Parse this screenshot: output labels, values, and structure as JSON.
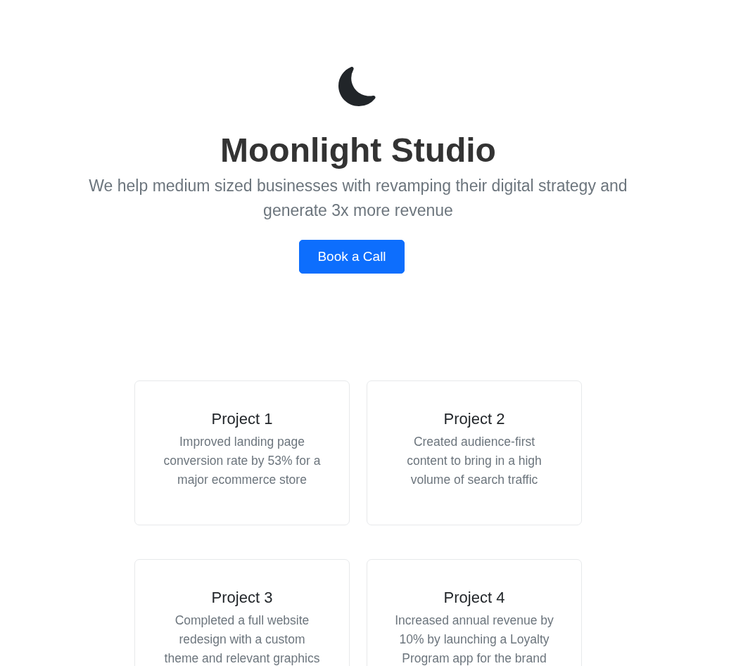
{
  "hero": {
    "title": "Moonlight Studio",
    "subtitle": "We help medium sized businesses with revamping their digital strategy and generate 3x more revenue",
    "button": "Book a Call"
  },
  "projects": [
    {
      "title": "Project 1",
      "description": "Improved landing page conversion rate by 53% for a major ecommerce store"
    },
    {
      "title": "Project 2",
      "description": "Created audience-first content to bring in a high volume of search traffic"
    },
    {
      "title": "Project 3",
      "description": "Completed a full website redesign with a custom theme and relevant graphics"
    },
    {
      "title": "Project 4",
      "description": "Increased annual revenue by 10% by launching a Loyalty Program app for the brand"
    }
  ]
}
